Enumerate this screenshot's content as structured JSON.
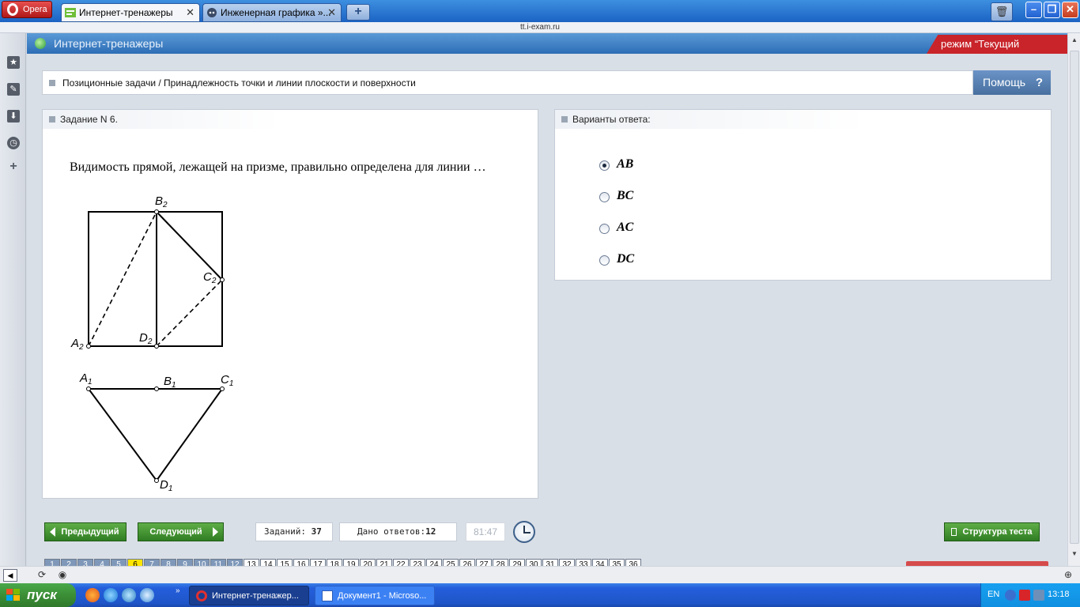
{
  "browser": {
    "opera_label": "Opera",
    "tabs": [
      {
        "title": "Интернет-тренажеры",
        "close": "✕"
      },
      {
        "title": "Инженерная графика »...",
        "close": "✕"
      }
    ],
    "new_tab": "+",
    "url": "tt.i-exam.ru"
  },
  "site": {
    "title": "Интернет-тренажеры",
    "mode": "режим “Текущий контроль”"
  },
  "breadcrumb": "Позиционные задачи / Принадлежность точки и линии плоскости и поверхности",
  "help_label": "Помощь",
  "help_icon": "?",
  "task": {
    "heading": "Задание N 6.",
    "question": "Видимость прямой, лежащей на призме, правильно определена для линии …",
    "figure_labels": {
      "B2": {
        "base": "B",
        "sub": "2"
      },
      "C2": {
        "base": "C",
        "sub": "2"
      },
      "A2": {
        "base": "A",
        "sub": "2"
      },
      "D2": {
        "base": "D",
        "sub": "2"
      },
      "A1": {
        "base": "A",
        "sub": "1"
      },
      "B1": {
        "base": "B",
        "sub": "1"
      },
      "C1": {
        "base": "C",
        "sub": "1"
      },
      "D1": {
        "base": "D",
        "sub": "1"
      }
    }
  },
  "answers": {
    "heading": "Варианты ответа:",
    "options": [
      {
        "label": "AB",
        "selected": true
      },
      {
        "label": "BC",
        "selected": false
      },
      {
        "label": "AC",
        "selected": false
      },
      {
        "label": "DC",
        "selected": false
      }
    ]
  },
  "toolbar": {
    "prev": "Предыдущий",
    "next": "Следующий",
    "tasks_label": "Заданий:",
    "tasks_count": "37",
    "answers_label": "Дано ответов:",
    "answers_count": "12",
    "timer": "81:47",
    "structure": "Структура теста"
  },
  "pager": {
    "pages": [
      "1",
      "2",
      "3",
      "4",
      "5",
      "6",
      "7",
      "8",
      "9",
      "10",
      "11",
      "12",
      "13",
      "14",
      "15",
      "16",
      "17",
      "18",
      "19",
      "20",
      "21",
      "22",
      "23",
      "24",
      "25",
      "26",
      "27",
      "28",
      "29",
      "30",
      "31",
      "32",
      "33",
      "34",
      "35",
      "36"
    ],
    "current": "6",
    "answered_count": 12
  },
  "taskbar": {
    "start": "пуск",
    "quicklaunch_more": "»",
    "windows": [
      "Интернет-тренажер...",
      "Документ1 - Microso..."
    ],
    "lang": "EN",
    "time": "13:18"
  },
  "colors": {
    "mode_badge": "#c8242a",
    "green_button": "#3f8f2f",
    "header_blue": "#2d6db6",
    "current_page": "#ffe600"
  }
}
